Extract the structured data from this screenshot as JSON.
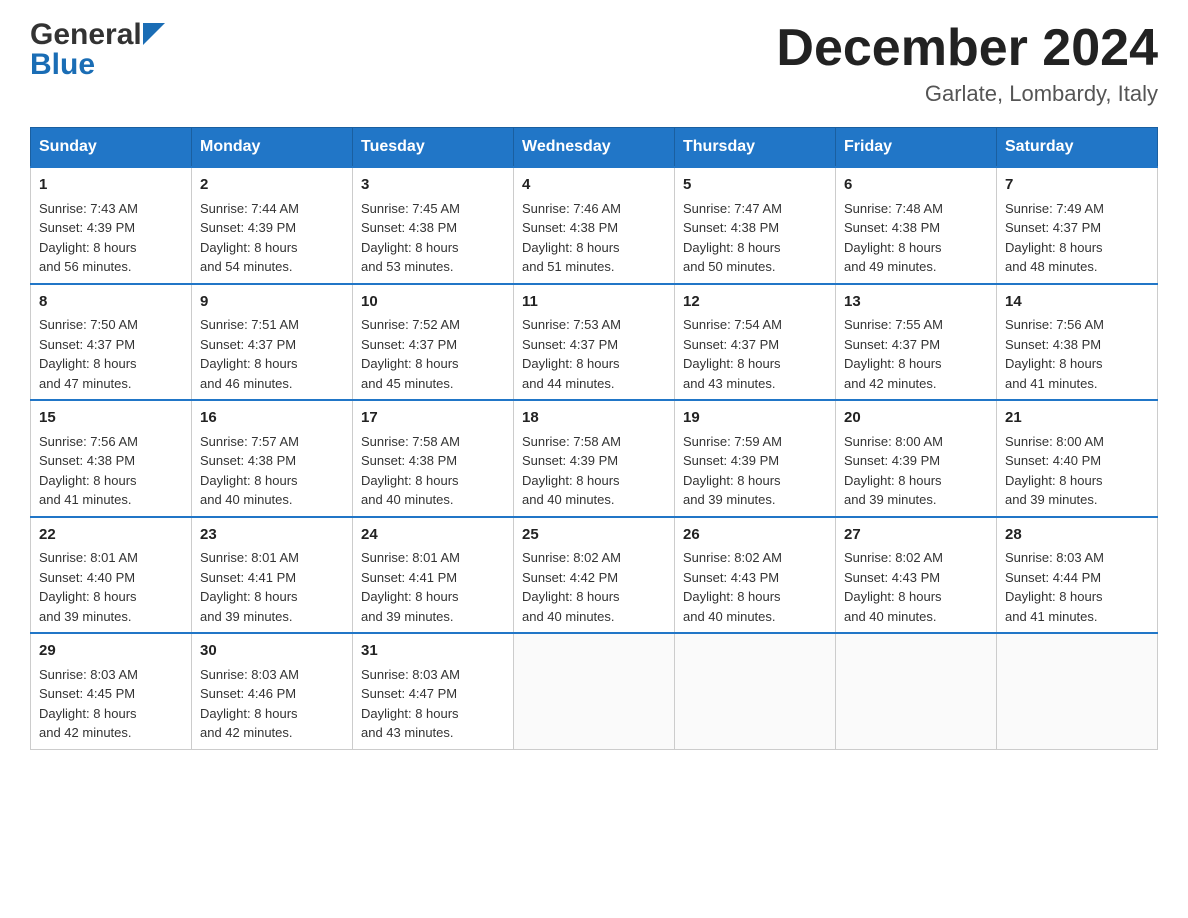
{
  "header": {
    "logo_general": "General",
    "logo_blue": "Blue",
    "month_title": "December 2024",
    "location": "Garlate, Lombardy, Italy"
  },
  "weekdays": [
    "Sunday",
    "Monday",
    "Tuesday",
    "Wednesday",
    "Thursday",
    "Friday",
    "Saturday"
  ],
  "weeks": [
    [
      {
        "day": "1",
        "sunrise": "7:43 AM",
        "sunset": "4:39 PM",
        "daylight": "8 hours and 56 minutes."
      },
      {
        "day": "2",
        "sunrise": "7:44 AM",
        "sunset": "4:39 PM",
        "daylight": "8 hours and 54 minutes."
      },
      {
        "day": "3",
        "sunrise": "7:45 AM",
        "sunset": "4:38 PM",
        "daylight": "8 hours and 53 minutes."
      },
      {
        "day": "4",
        "sunrise": "7:46 AM",
        "sunset": "4:38 PM",
        "daylight": "8 hours and 51 minutes."
      },
      {
        "day": "5",
        "sunrise": "7:47 AM",
        "sunset": "4:38 PM",
        "daylight": "8 hours and 50 minutes."
      },
      {
        "day": "6",
        "sunrise": "7:48 AM",
        "sunset": "4:38 PM",
        "daylight": "8 hours and 49 minutes."
      },
      {
        "day": "7",
        "sunrise": "7:49 AM",
        "sunset": "4:37 PM",
        "daylight": "8 hours and 48 minutes."
      }
    ],
    [
      {
        "day": "8",
        "sunrise": "7:50 AM",
        "sunset": "4:37 PM",
        "daylight": "8 hours and 47 minutes."
      },
      {
        "day": "9",
        "sunrise": "7:51 AM",
        "sunset": "4:37 PM",
        "daylight": "8 hours and 46 minutes."
      },
      {
        "day": "10",
        "sunrise": "7:52 AM",
        "sunset": "4:37 PM",
        "daylight": "8 hours and 45 minutes."
      },
      {
        "day": "11",
        "sunrise": "7:53 AM",
        "sunset": "4:37 PM",
        "daylight": "8 hours and 44 minutes."
      },
      {
        "day": "12",
        "sunrise": "7:54 AM",
        "sunset": "4:37 PM",
        "daylight": "8 hours and 43 minutes."
      },
      {
        "day": "13",
        "sunrise": "7:55 AM",
        "sunset": "4:37 PM",
        "daylight": "8 hours and 42 minutes."
      },
      {
        "day": "14",
        "sunrise": "7:56 AM",
        "sunset": "4:38 PM",
        "daylight": "8 hours and 41 minutes."
      }
    ],
    [
      {
        "day": "15",
        "sunrise": "7:56 AM",
        "sunset": "4:38 PM",
        "daylight": "8 hours and 41 minutes."
      },
      {
        "day": "16",
        "sunrise": "7:57 AM",
        "sunset": "4:38 PM",
        "daylight": "8 hours and 40 minutes."
      },
      {
        "day": "17",
        "sunrise": "7:58 AM",
        "sunset": "4:38 PM",
        "daylight": "8 hours and 40 minutes."
      },
      {
        "day": "18",
        "sunrise": "7:58 AM",
        "sunset": "4:39 PM",
        "daylight": "8 hours and 40 minutes."
      },
      {
        "day": "19",
        "sunrise": "7:59 AM",
        "sunset": "4:39 PM",
        "daylight": "8 hours and 39 minutes."
      },
      {
        "day": "20",
        "sunrise": "8:00 AM",
        "sunset": "4:39 PM",
        "daylight": "8 hours and 39 minutes."
      },
      {
        "day": "21",
        "sunrise": "8:00 AM",
        "sunset": "4:40 PM",
        "daylight": "8 hours and 39 minutes."
      }
    ],
    [
      {
        "day": "22",
        "sunrise": "8:01 AM",
        "sunset": "4:40 PM",
        "daylight": "8 hours and 39 minutes."
      },
      {
        "day": "23",
        "sunrise": "8:01 AM",
        "sunset": "4:41 PM",
        "daylight": "8 hours and 39 minutes."
      },
      {
        "day": "24",
        "sunrise": "8:01 AM",
        "sunset": "4:41 PM",
        "daylight": "8 hours and 39 minutes."
      },
      {
        "day": "25",
        "sunrise": "8:02 AM",
        "sunset": "4:42 PM",
        "daylight": "8 hours and 40 minutes."
      },
      {
        "day": "26",
        "sunrise": "8:02 AM",
        "sunset": "4:43 PM",
        "daylight": "8 hours and 40 minutes."
      },
      {
        "day": "27",
        "sunrise": "8:02 AM",
        "sunset": "4:43 PM",
        "daylight": "8 hours and 40 minutes."
      },
      {
        "day": "28",
        "sunrise": "8:03 AM",
        "sunset": "4:44 PM",
        "daylight": "8 hours and 41 minutes."
      }
    ],
    [
      {
        "day": "29",
        "sunrise": "8:03 AM",
        "sunset": "4:45 PM",
        "daylight": "8 hours and 42 minutes."
      },
      {
        "day": "30",
        "sunrise": "8:03 AM",
        "sunset": "4:46 PM",
        "daylight": "8 hours and 42 minutes."
      },
      {
        "day": "31",
        "sunrise": "8:03 AM",
        "sunset": "4:47 PM",
        "daylight": "8 hours and 43 minutes."
      },
      null,
      null,
      null,
      null
    ]
  ],
  "labels": {
    "sunrise": "Sunrise:",
    "sunset": "Sunset:",
    "daylight": "Daylight:"
  }
}
